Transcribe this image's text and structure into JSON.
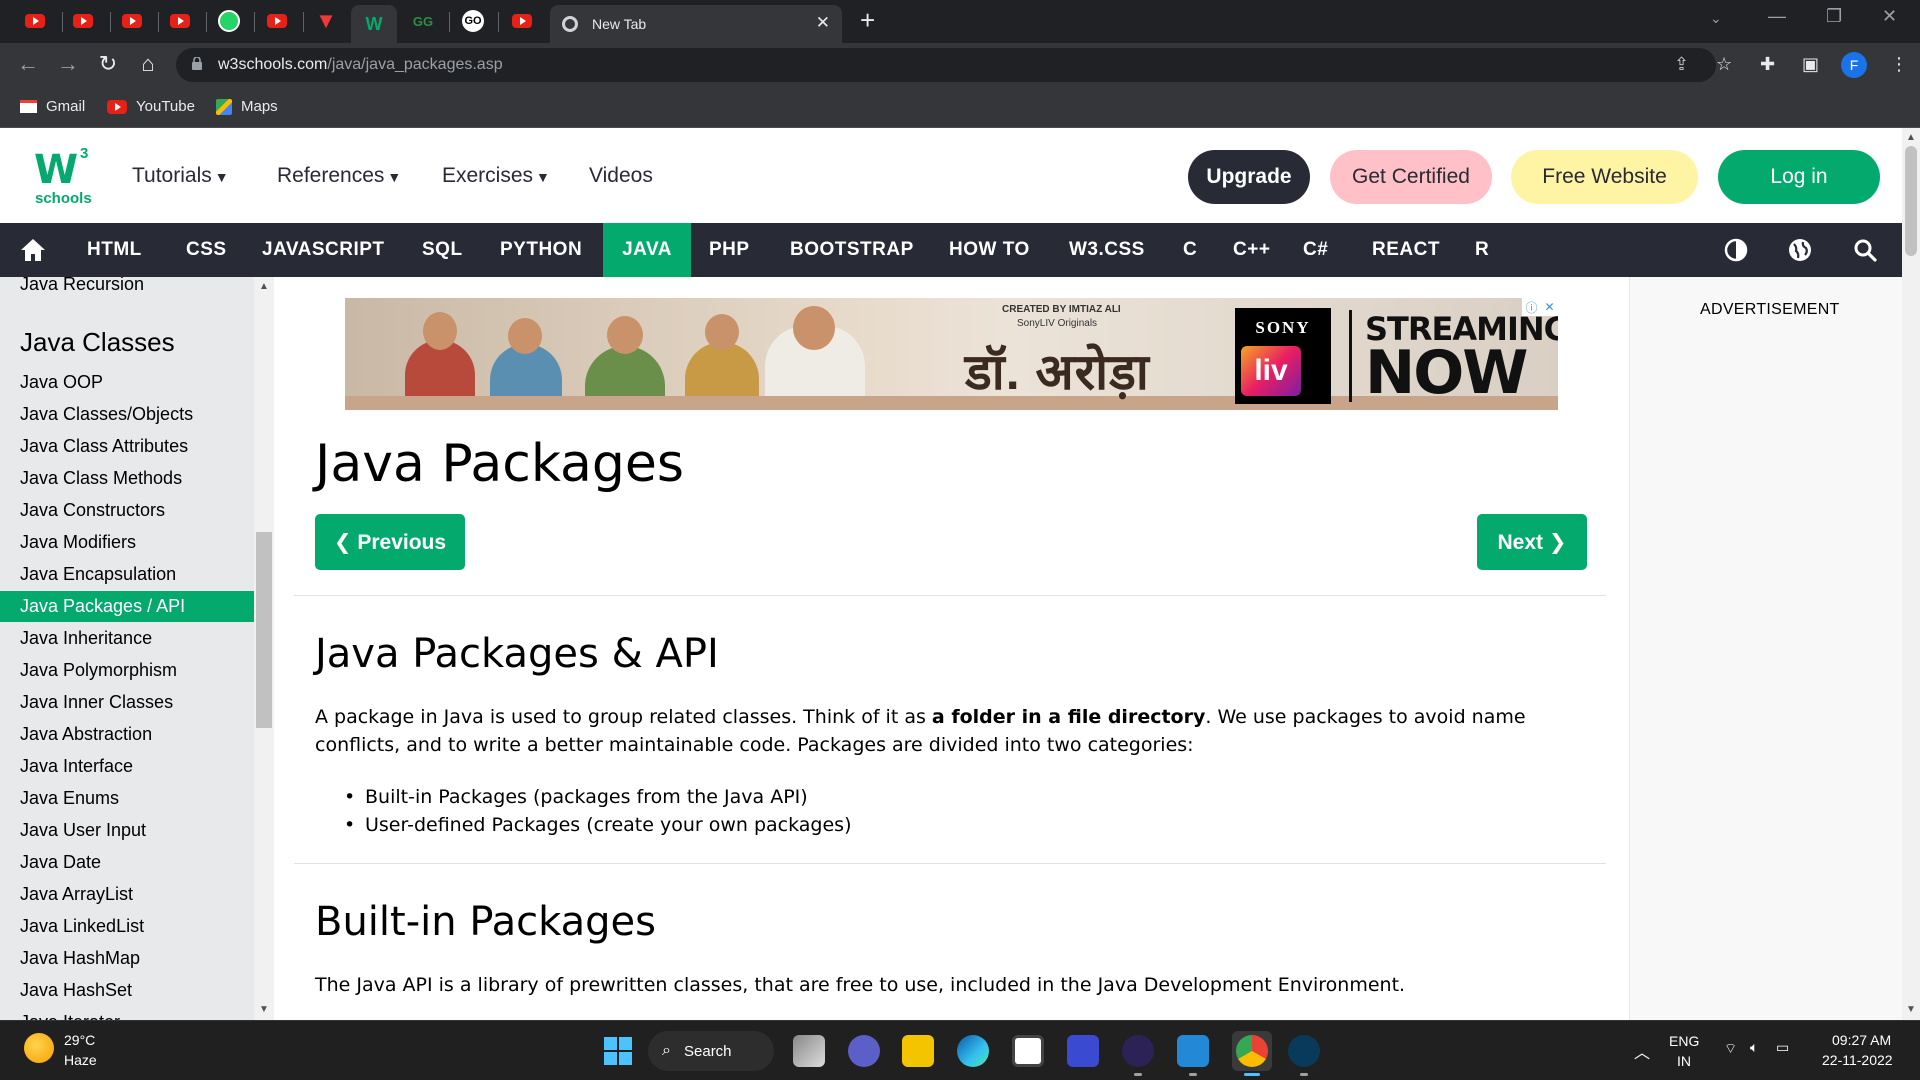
{
  "browser": {
    "tab_title": "New Tab",
    "url_host": "w3schools.com",
    "url_path": "/java/java_packages.asp",
    "profile_initial": "F",
    "bookmarks": [
      "Gmail",
      "YouTube",
      "Maps"
    ]
  },
  "header": {
    "logo_mark": "W",
    "logo_sup": "3",
    "logo_text": "schools",
    "nav": [
      "Tutorials",
      "References",
      "Exercises",
      "Videos"
    ],
    "buttons": {
      "upgrade": "Upgrade",
      "certified": "Get Certified",
      "free_website": "Free Website",
      "login": "Log in"
    }
  },
  "topnav": {
    "items": [
      "HTML",
      "CSS",
      "JAVASCRIPT",
      "SQL",
      "PYTHON",
      "JAVA",
      "PHP",
      "BOOTSTRAP",
      "HOW TO",
      "W3.CSS",
      "C",
      "C++",
      "C#",
      "REACT",
      "R"
    ],
    "active": "JAVA"
  },
  "sidebar": {
    "top_item": "Java Recursion",
    "heading": "Java Classes",
    "items": [
      "Java OOP",
      "Java Classes/Objects",
      "Java Class Attributes",
      "Java Class Methods",
      "Java Constructors",
      "Java Modifiers",
      "Java Encapsulation",
      "Java Packages / API",
      "Java Inheritance",
      "Java Polymorphism",
      "Java Inner Classes",
      "Java Abstraction",
      "Java Interface",
      "Java Enums",
      "Java User Input",
      "Java Date",
      "Java ArrayList",
      "Java LinkedList",
      "Java HashMap",
      "Java HashSet",
      "Java Iterator"
    ],
    "active_item": "Java Packages / API"
  },
  "ad": {
    "credit_line1": "CREATED BY IMTIAZ ALI",
    "credit_line2": "SonyLIV Originals",
    "title_hindi": "डॉ. अरोड़ा",
    "brand": "SONY",
    "brand_sub": "liv",
    "tagline1": "STREAMING",
    "tagline2": "NOW"
  },
  "main": {
    "page_title": "Java Packages",
    "prev_label": "❮ Previous",
    "next_label": "Next ❯",
    "section1_title": "Java Packages & API",
    "section1_text_a": "A package in Java is used to group related classes. Think of it as ",
    "section1_text_bold": "a folder in a file directory",
    "section1_text_b": ". We use packages to avoid name conflicts, and to write a better maintainable code. Packages are divided into two categories:",
    "bullets": [
      "Built-in Packages (packages from the Java API)",
      "User-defined Packages (create your own packages)"
    ],
    "section2_title": "Built-in Packages",
    "section2_text": "The Java API is a library of prewritten classes, that are free to use, included in the Java Development Environment."
  },
  "rightcol": {
    "advert_label": "ADVERTISEMENT"
  },
  "taskbar": {
    "temp": "29°C",
    "condition": "Haze",
    "search_label": "Search",
    "lang1": "ENG",
    "lang2": "IN",
    "time": "09:27 AM",
    "date": "22-11-2022"
  },
  "colors": {
    "w3_green": "#04aa6d",
    "dark_nav": "#282a35",
    "certified_pink": "#ffc0c7",
    "free_yellow": "#fff4a3",
    "sidebar_bg": "#e7e9eb"
  }
}
